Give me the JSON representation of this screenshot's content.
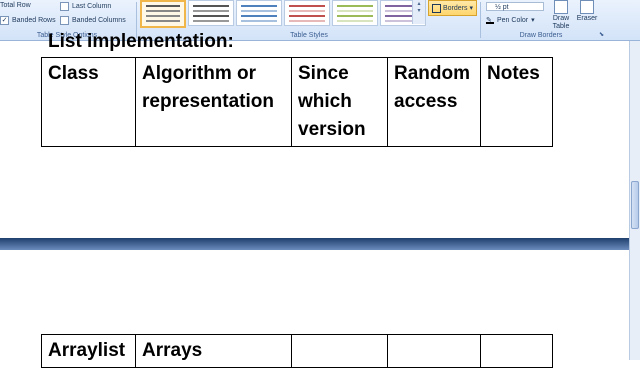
{
  "ribbon": {
    "table_style_options": {
      "label": "Table Style Options",
      "total_row": "Total Row",
      "last_column": "Last Column",
      "banded_rows": "Banded Rows",
      "banded_columns": "Banded Columns",
      "banded_rows_checked": "✓"
    },
    "table_styles": {
      "label": "Table Styles",
      "borders": "Borders",
      "borders_arrow": "▾"
    },
    "draw_borders": {
      "label": "Draw Borders",
      "pen_weight": "½ pt",
      "pen_color": "Pen Color",
      "pen_color_arrow": "▾",
      "draw_table": "Draw Table",
      "eraser": "Eraser",
      "launcher": "⬊"
    }
  },
  "document": {
    "heading": "List implementation:",
    "header_table": {
      "cells": [
        "Class",
        "Algorithm or representation",
        "Since which version",
        "Random access",
        "Notes"
      ]
    },
    "row_table": {
      "cells": [
        "Arraylist",
        "Arrays",
        "",
        "",
        ""
      ]
    }
  },
  "colors": {
    "ribbon_bg": "#dbe7f8",
    "page_gap": "#1f3f6d",
    "selected_style": "#f0b64a"
  }
}
